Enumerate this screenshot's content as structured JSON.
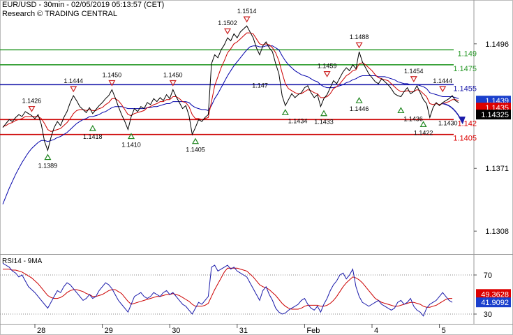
{
  "header": {
    "symbol_line": "EUR/USD - 30min - 02/05/2019 05:13:57 (CET)",
    "source_line": "Research © TRADING CENTRAL"
  },
  "chart_data": [
    {
      "type": "line",
      "panel": "price",
      "ylim": [
        1.1285,
        1.154
      ],
      "y_ticks": [
        "1.1496",
        "1.1371",
        "1.1308"
      ],
      "y_tick_values": [
        1.1496,
        1.1371,
        1.1308
      ],
      "x_ticks": [
        "28",
        "29",
        "30",
        "31",
        "Feb",
        "4",
        "5"
      ],
      "x_tick_index": [
        5,
        26,
        47,
        68,
        89,
        110,
        131
      ],
      "x_count": 141,
      "grid": false,
      "series": [
        {
          "role": "price",
          "color": "#000000",
          "values": [
            1.1412,
            1.1416,
            1.142,
            1.1418,
            1.1422,
            1.1425,
            1.1423,
            1.1428,
            1.1426,
            1.1424,
            1.1421,
            1.1425,
            1.1415,
            1.1398,
            1.1389,
            1.1402,
            1.1412,
            1.1418,
            1.1414,
            1.1422,
            1.1428,
            1.1437,
            1.1444,
            1.1439,
            1.1433,
            1.143,
            1.1427,
            1.1432,
            1.1426,
            1.143,
            1.1434,
            1.1437,
            1.1441,
            1.1444,
            1.145,
            1.1442,
            1.1433,
            1.1425,
            1.1418,
            1.141,
            1.1423,
            1.1431,
            1.1428,
            1.1433,
            1.1431,
            1.1437,
            1.1435,
            1.1441,
            1.1438,
            1.1442,
            1.1439,
            1.1445,
            1.1441,
            1.145,
            1.1443,
            1.1437,
            1.1431,
            1.1434,
            1.1424,
            1.1405,
            1.1412,
            1.142,
            1.1418,
            1.1422,
            1.1425,
            1.1476,
            1.1485,
            1.1482,
            1.149,
            1.1495,
            1.1502,
            1.1499,
            1.1506,
            1.1502,
            1.1508,
            1.1511,
            1.1514,
            1.1508,
            1.1502,
            1.1492,
            1.1485,
            1.1494,
            1.1498,
            1.1492,
            1.1488,
            1.1476,
            1.1466,
            1.1444,
            1.1434,
            1.144,
            1.1446,
            1.1442,
            1.1445,
            1.1447,
            1.1452,
            1.1454,
            1.1447,
            1.1442,
            1.1445,
            1.1433,
            1.1441,
            1.1445,
            1.1452,
            1.1459,
            1.1456,
            1.1462,
            1.1468,
            1.1472,
            1.1469,
            1.1475,
            1.1471,
            1.1488,
            1.1478,
            1.1472,
            1.1466,
            1.1462,
            1.1458,
            1.1456,
            1.1461,
            1.1458,
            1.1455,
            1.1451,
            1.1446,
            1.1444,
            1.1443,
            1.1448,
            1.1452,
            1.1446,
            1.1448,
            1.1454,
            1.1447,
            1.144,
            1.1436,
            1.1422,
            1.1432,
            1.1437,
            1.1434,
            1.1437,
            1.1439,
            1.1441,
            1.1444,
            1.1439,
            1.1437
          ]
        },
        {
          "role": "moving-average-fast",
          "color": "#cc0000",
          "values": [
            1.1413,
            1.1414,
            1.1416,
            1.1417,
            1.1419,
            1.142,
            1.1421,
            1.1423,
            1.1423,
            1.1423,
            1.1423,
            1.1423,
            1.1421,
            1.1416,
            1.141,
            1.1408,
            1.1409,
            1.141,
            1.1411,
            1.1414,
            1.1417,
            1.1421,
            1.1426,
            1.1429,
            1.143,
            1.143,
            1.1429,
            1.143,
            1.1429,
            1.1429,
            1.1431,
            1.1432,
            1.1435,
            1.1437,
            1.1441,
            1.1441,
            1.1439,
            1.1435,
            1.143,
            1.1425,
            1.1424,
            1.1426,
            1.1427,
            1.1428,
            1.1429,
            1.1432,
            1.1433,
            1.1435,
            1.1436,
            1.1438,
            1.1438,
            1.144,
            1.144,
            1.1443,
            1.1443,
            1.1441,
            1.1438,
            1.1437,
            1.1433,
            1.1425,
            1.1421,
            1.1421,
            1.142,
            1.1421,
            1.1422,
            1.1438,
            1.1454,
            1.1463,
            1.1472,
            1.1479,
            1.1487,
            1.1491,
            1.1496,
            1.1498,
            1.1501,
            1.1504,
            1.1507,
            1.1507,
            1.1506,
            1.1501,
            1.1496,
            1.1495,
            1.1496,
            1.1495,
            1.1492,
            1.1487,
            1.1479,
            1.1467,
            1.1456,
            1.1451,
            1.1449,
            1.1447,
            1.1446,
            1.1446,
            1.1448,
            1.145,
            1.1449,
            1.1447,
            1.1446,
            1.1442,
            1.1442,
            1.1443,
            1.1446,
            1.1451,
            1.1453,
            1.1456,
            1.146,
            1.1464,
            1.1466,
            1.1469,
            1.147,
            1.1476,
            1.1477,
            1.1475,
            1.1472,
            1.1469,
            1.1465,
            1.1462,
            1.1461,
            1.146,
            1.1459,
            1.1456,
            1.1453,
            1.145,
            1.1448,
            1.1448,
            1.1449,
            1.1448,
            1.1448,
            1.145,
            1.1449,
            1.1446,
            1.1443,
            1.1436,
            1.1435,
            1.1436,
            1.1435,
            1.1436,
            1.1437,
            1.1438,
            1.144,
            1.144,
            1.1439
          ]
        },
        {
          "role": "moving-average-slow",
          "color": "#0000aa",
          "values": [
            1.1335,
            1.1343,
            1.1351,
            1.1358,
            1.1365,
            1.1371,
            1.1377,
            1.1382,
            1.1387,
            1.1391,
            1.1394,
            1.1397,
            1.1399,
            1.1399,
            1.1398,
            1.1399,
            1.14,
            1.1402,
            1.1403,
            1.1405,
            1.1407,
            1.141,
            1.1413,
            1.1416,
            1.1418,
            1.142,
            1.1421,
            1.1423,
            1.1423,
            1.1424,
            1.1425,
            1.1427,
            1.1428,
            1.143,
            1.1432,
            1.1433,
            1.1433,
            1.1433,
            1.1432,
            1.1431,
            1.1431,
            1.1431,
            1.1431,
            1.1431,
            1.1431,
            1.1432,
            1.1432,
            1.1433,
            1.1433,
            1.1434,
            1.1435,
            1.1436,
            1.1436,
            1.1438,
            1.1438,
            1.1438,
            1.1438,
            1.1438,
            1.1437,
            1.1434,
            1.1432,
            1.1431,
            1.143,
            1.143,
            1.1429,
            1.1434,
            1.1441,
            1.1446,
            1.1452,
            1.1458,
            1.1464,
            1.1469,
            1.1474,
            1.1478,
            1.1482,
            1.1486,
            1.149,
            1.1493,
            1.1494,
            1.1494,
            1.1493,
            1.1493,
            1.1494,
            1.1494,
            1.1494,
            1.1492,
            1.149,
            1.1484,
            1.1479,
            1.1475,
            1.1472,
            1.1469,
            1.1467,
            1.1465,
            1.1464,
            1.1463,
            1.1461,
            1.1459,
            1.1458,
            1.1455,
            1.1453,
            1.1452,
            1.1452,
            1.1452,
            1.1453,
            1.1454,
            1.1455,
            1.1457,
            1.1458,
            1.146,
            1.1461,
            1.1463,
            1.1464,
            1.1464,
            1.1464,
            1.1464,
            1.1464,
            1.1463,
            1.1463,
            1.1463,
            1.1462,
            1.1461,
            1.146,
            1.1458,
            1.1457,
            1.1456,
            1.1456,
            1.1455,
            1.1455,
            1.1455,
            1.1454,
            1.1453,
            1.1451,
            1.1447,
            1.1446,
            1.1445,
            1.1444,
            1.1443,
            1.1443,
            1.1443,
            1.1443,
            1.1442,
            1.1441
          ]
        }
      ],
      "levels": [
        {
          "label": "1.149",
          "value": 1.149,
          "color": "#2a9a2a",
          "label_color": "#2a9a2a"
        },
        {
          "label": "1.1475",
          "value": 1.1475,
          "color": "#2a9a2a",
          "label_color": "#2a9a2a"
        },
        {
          "label": "1.1455",
          "value": 1.1455,
          "color": "#1a1aaa",
          "label_color": "#1a1aaa"
        },
        {
          "label": "1.142",
          "value": 1.142,
          "color": "#cc0000",
          "label_color": "#dd0000"
        },
        {
          "label": "1.1405",
          "value": 1.1405,
          "color": "#cc0000",
          "label_color": "#dd0000"
        }
      ],
      "price_tags": [
        {
          "label": "1.1439",
          "value": 1.1439,
          "bg": "#1a3fcc",
          "fg": "#ffffff"
        },
        {
          "label": "1.1435",
          "value": 1.1432,
          "bg": "#dd0000",
          "fg": "#ffffff"
        },
        {
          "label": "1.14325",
          "value": 1.1425,
          "bg": "#000000",
          "fg": "#ffffff"
        }
      ],
      "annotations": [
        {
          "label": "1.1426",
          "i": 9,
          "v": 1.1424,
          "kind": "high"
        },
        {
          "label": "1.1444",
          "i": 22,
          "v": 1.1444,
          "kind": "high"
        },
        {
          "label": "1.1450",
          "i": 34,
          "v": 1.145,
          "kind": "high"
        },
        {
          "label": "1.1450",
          "i": 53,
          "v": 1.145,
          "kind": "high"
        },
        {
          "label": "1.1502",
          "i": 70,
          "v": 1.1502,
          "kind": "high"
        },
        {
          "label": "1.1514",
          "i": 76,
          "v": 1.1514,
          "kind": "high"
        },
        {
          "label": "1.1459",
          "i": 101,
          "v": 1.1459,
          "kind": "high"
        },
        {
          "label": "1.1488",
          "i": 111,
          "v": 1.1488,
          "kind": "high"
        },
        {
          "label": "1.1454",
          "i": 128,
          "v": 1.1454,
          "kind": "high"
        },
        {
          "label": "1.1444",
          "i": 137,
          "v": 1.1444,
          "kind": "high"
        },
        {
          "label": "1.1389",
          "i": 14,
          "v": 1.1389,
          "kind": "low"
        },
        {
          "label": "1.1418",
          "i": 28,
          "v": 1.1418,
          "kind": "low"
        },
        {
          "label": "1.1410",
          "i": 40,
          "v": 1.141,
          "kind": "low"
        },
        {
          "label": "1.1405",
          "i": 60,
          "v": 1.1405,
          "kind": "low"
        },
        {
          "label": "1.1434",
          "i": 88,
          "v": 1.1434,
          "kind": "low",
          "label_side": "right"
        },
        {
          "label": "1.1433",
          "i": 100,
          "v": 1.1433,
          "kind": "low"
        },
        {
          "label": "1.1446",
          "i": 111,
          "v": 1.1446,
          "kind": "low"
        },
        {
          "label": "1.1436",
          "i": 124,
          "v": 1.1436,
          "kind": "low",
          "label_side": "right"
        },
        {
          "label": "1.1422",
          "i": 131,
          "v": 1.1422,
          "kind": "low"
        }
      ],
      "inline_labels": [
        {
          "label": "1.147",
          "i": 82,
          "v": 1.1455
        },
        {
          "label": "1.1430",
          "i": 140,
          "v": 1.1417
        }
      ],
      "forecast_arrow": {
        "from_i": 137,
        "from_v": 1.1436,
        "to_i": 143,
        "to_v": 1.1418,
        "color": "#1a1aaa"
      }
    },
    {
      "type": "line",
      "panel": "oscillator",
      "title": "RSI14 - 9MA",
      "ylim": [
        20,
        90
      ],
      "y_ticks": [
        "70",
        "30"
      ],
      "y_tick_values": [
        70,
        30
      ],
      "guides": [
        70,
        30
      ],
      "series": [
        {
          "role": "rsi",
          "color": "#1a1aaa",
          "values": [
            82,
            80,
            78,
            74,
            72,
            68,
            70,
            64,
            58,
            55,
            52,
            48,
            44,
            40,
            36,
            42,
            48,
            54,
            52,
            58,
            62,
            60,
            56,
            52,
            48,
            44,
            46,
            50,
            46,
            48,
            54,
            58,
            62,
            60,
            56,
            50,
            44,
            40,
            36,
            32,
            40,
            48,
            50,
            52,
            48,
            46,
            48,
            52,
            50,
            48,
            52,
            54,
            50,
            52,
            48,
            44,
            40,
            38,
            34,
            30,
            36,
            42,
            40,
            44,
            48,
            78,
            80,
            74,
            76,
            78,
            80,
            76,
            78,
            74,
            72,
            70,
            68,
            62,
            56,
            50,
            44,
            54,
            58,
            50,
            44,
            36,
            32,
            30,
            31,
            34,
            36,
            38,
            40,
            44,
            46,
            40,
            36,
            34,
            38,
            32,
            40,
            46,
            54,
            60,
            64,
            70,
            72,
            66,
            70,
            76,
            58,
            48,
            42,
            40,
            38,
            40,
            42,
            44,
            40,
            38,
            36,
            34,
            36,
            42,
            44,
            40,
            42,
            46,
            38,
            34,
            32,
            28,
            36,
            40,
            42,
            44,
            48,
            52,
            48,
            44,
            42
          ]
        },
        {
          "role": "rsi-moving-average",
          "color": "#cc0000",
          "values": [
            76,
            76,
            76,
            75,
            75,
            74,
            73,
            71,
            69,
            67,
            64,
            61,
            57,
            53,
            49,
            47,
            46,
            46,
            47,
            49,
            52,
            54,
            55,
            55,
            54,
            53,
            51,
            50,
            48,
            48,
            49,
            50,
            52,
            54,
            55,
            55,
            53,
            51,
            47,
            43,
            40,
            41,
            42,
            43,
            44,
            45,
            46,
            47,
            48,
            48,
            49,
            50,
            50,
            51,
            50,
            49,
            47,
            45,
            43,
            40,
            38,
            38,
            38,
            39,
            41,
            48,
            55,
            61,
            67,
            73,
            77,
            77,
            77,
            77,
            76,
            75,
            74,
            71,
            68,
            64,
            60,
            58,
            57,
            55,
            52,
            49,
            45,
            41,
            38,
            36,
            35,
            35,
            35,
            36,
            38,
            39,
            39,
            39,
            39,
            38,
            38,
            39,
            41,
            44,
            48,
            53,
            58,
            62,
            65,
            68,
            67,
            65,
            62,
            58,
            54,
            50,
            46,
            44,
            42,
            41,
            40,
            39,
            38,
            38,
            39,
            40,
            41,
            42,
            42,
            41,
            40,
            38,
            37,
            37,
            38,
            39,
            41,
            43,
            45,
            46,
            46
          ]
        }
      ],
      "value_tags": [
        {
          "label": "49.3628",
          "value": 50.5,
          "bg": "#dd0000",
          "fg": "#ffffff"
        },
        {
          "label": "41.9092",
          "value": 42,
          "bg": "#1a3fcc",
          "fg": "#ffffff"
        }
      ]
    }
  ]
}
